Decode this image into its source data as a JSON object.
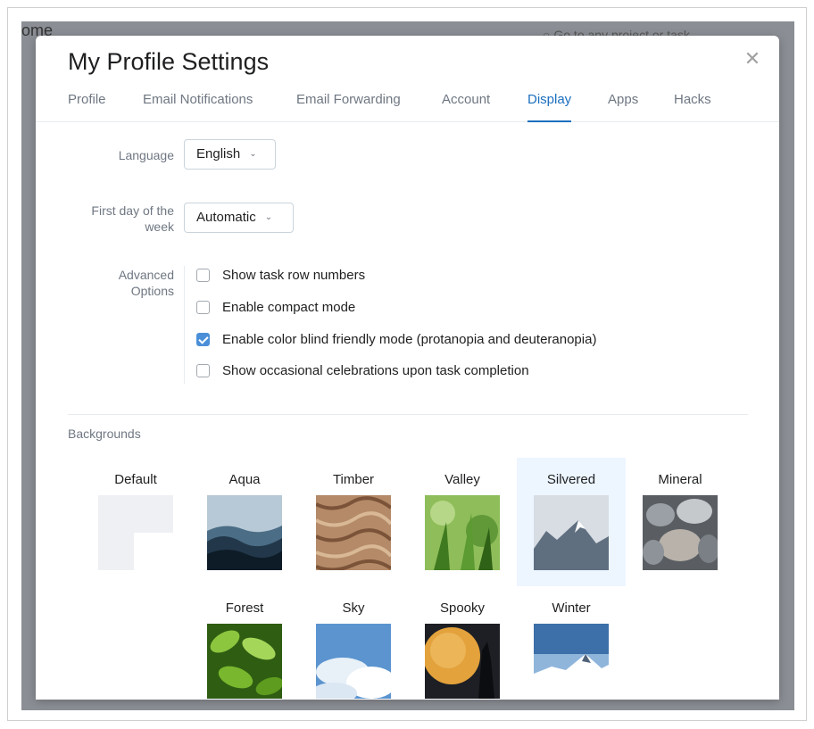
{
  "background_app": {
    "title_fragment": "ome",
    "search_placeholder": "Go to any project or task"
  },
  "modal": {
    "title": "My Profile Settings",
    "close_icon": "close-icon"
  },
  "tabs": [
    {
      "label": "Profile",
      "active": false
    },
    {
      "label": "Email Notifications",
      "active": false
    },
    {
      "label": "Email Forwarding",
      "active": false
    },
    {
      "label": "Account",
      "active": false
    },
    {
      "label": "Display",
      "active": true
    },
    {
      "label": "Apps",
      "active": false
    },
    {
      "label": "Hacks",
      "active": false
    }
  ],
  "display": {
    "language": {
      "label": "Language",
      "value": "English"
    },
    "first_day": {
      "label_line1": "First day of the",
      "label_line2": "week",
      "value": "Automatic"
    },
    "advanced": {
      "label_line1": "Advanced",
      "label_line2": "Options",
      "options": [
        {
          "label": "Show task row numbers",
          "checked": false
        },
        {
          "label": "Enable compact mode",
          "checked": false
        },
        {
          "label": "Enable color blind friendly mode (protanopia and deuteranopia)",
          "checked": true
        },
        {
          "label": "Show occasional celebrations upon task completion",
          "checked": false
        }
      ]
    }
  },
  "backgrounds": {
    "title": "Backgrounds",
    "items": [
      {
        "label": "Default",
        "selected": false
      },
      {
        "label": "Aqua",
        "selected": false
      },
      {
        "label": "Timber",
        "selected": false
      },
      {
        "label": "Valley",
        "selected": false
      },
      {
        "label": "Silvered",
        "selected": true
      },
      {
        "label": "Mineral",
        "selected": false
      },
      {
        "label": "Forest",
        "selected": false
      },
      {
        "label": "Sky",
        "selected": false
      },
      {
        "label": "Spooky",
        "selected": false
      },
      {
        "label": "Winter",
        "selected": false
      }
    ]
  },
  "colors": {
    "accent": "#1c6fbf",
    "checkbox_checked": "#4b8fd8",
    "selected_tile": "#edf6ff"
  }
}
